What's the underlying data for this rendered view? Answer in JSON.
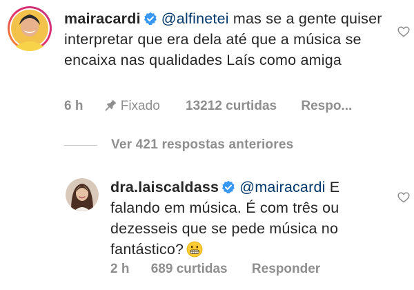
{
  "comments": [
    {
      "username": "mairacardi",
      "verified": true,
      "mention": "@alfinetei",
      "text": "mas se a gente quiser interpretar que era dela até que a música se encaixa nas qualidades Laís como amiga",
      "time": "6 h",
      "pinned_label": "Fixado",
      "likes": "13212 curtidas",
      "reply_label": "Respo...",
      "icons": [
        "verified-badge-icon",
        "pin-icon",
        "heart-icon"
      ]
    },
    {
      "username": "dra.laiscaldass",
      "verified": true,
      "mention": "@mairacardi",
      "text": "E falando em música. É com três ou dezesseis que se pede música no fantástico?",
      "emoji": "grimacing-face",
      "time": "2 h",
      "likes": "689 curtidas",
      "reply_label": "Responder",
      "icons": [
        "verified-badge-icon",
        "heart-icon"
      ]
    }
  ],
  "view_replies": {
    "label": "Ver 421 respostas anteriores"
  },
  "colors": {
    "text": "#262626",
    "mention": "#00376b",
    "meta": "#8e8e8e",
    "verified": "#3897f0",
    "avatar_ring": "#e1306c"
  }
}
